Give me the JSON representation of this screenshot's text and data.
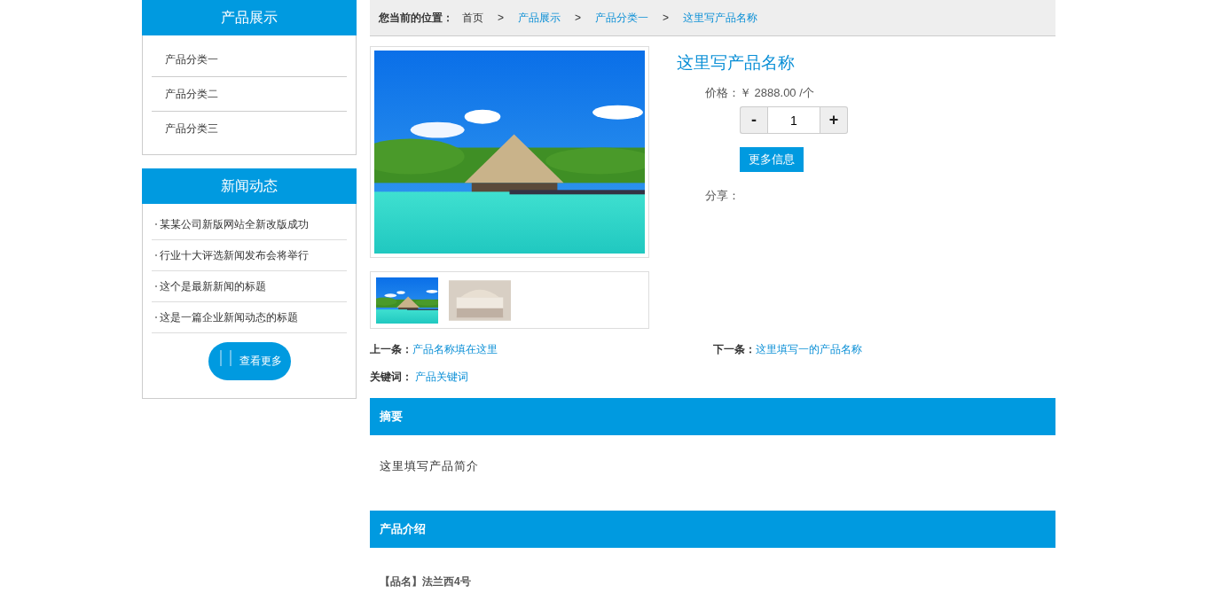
{
  "sidebar": {
    "categories": {
      "title": "产品展示",
      "items": [
        "产品分类一",
        "产品分类二",
        "产品分类三"
      ]
    },
    "news": {
      "title": "新闻动态",
      "items": [
        "某某公司新版网站全新改版成功",
        "行业十大评选新闻发布会将举行",
        "这个是最新新闻的标题",
        "这是一篇企业新闻动态的标题"
      ],
      "more_button": "查看更多"
    }
  },
  "breadcrumb": {
    "label": "您当前的位置：",
    "items": [
      {
        "text": "首页",
        "kind": "plain"
      },
      {
        "text": "产品展示",
        "kind": "link"
      },
      {
        "text": "产品分类一",
        "kind": "link"
      },
      {
        "text": "这里写产品名称",
        "kind": "link"
      }
    ],
    "separator": ">"
  },
  "product": {
    "name": "这里写产品名称",
    "price_label": "价格：",
    "price": "￥ 2888.00 /个",
    "minus": "-",
    "quantity": "1",
    "plus": "+",
    "more_info": "更多信息",
    "share_label": "分享：",
    "thumbnails": [
      {
        "kind": "beach"
      },
      {
        "kind": "bed"
      }
    ]
  },
  "prev": {
    "label": "上一条：",
    "link": "产品名称填在这里"
  },
  "next": {
    "label": "下一条：",
    "link": "这里填写一的产品名称"
  },
  "keywords": {
    "label": "关键词：",
    "link": "产品关键词"
  },
  "sections": [
    {
      "title": "摘要",
      "body": "这里填写产品简介",
      "kind": "plain"
    },
    {
      "title": "产品介绍",
      "body": "【品名】法兰西4号",
      "kind": "bold"
    }
  ]
}
